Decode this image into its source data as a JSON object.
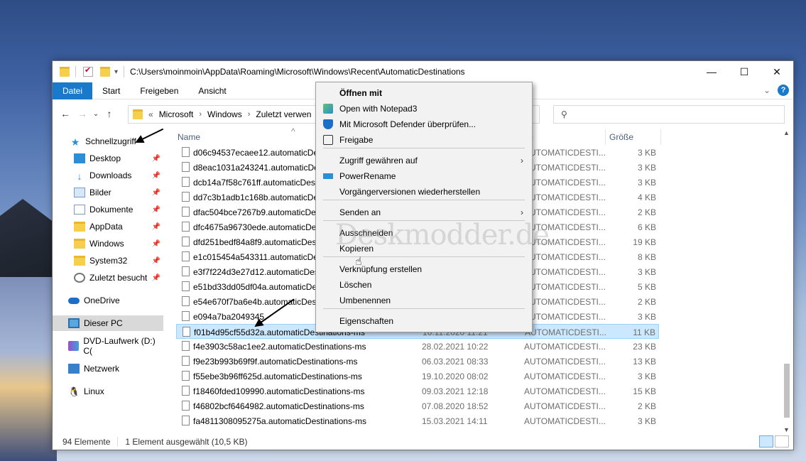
{
  "window": {
    "title_path": "C:\\Users\\moinmoin\\AppData\\Roaming\\Microsoft\\Windows\\Recent\\AutomaticDestinations",
    "minimize": "—",
    "maximize": "☐",
    "close": "✕"
  },
  "ribbon": {
    "tabs": [
      "Datei",
      "Start",
      "Freigeben",
      "Ansicht"
    ],
    "expand": "⌄",
    "help": "?"
  },
  "nav": {
    "back": "←",
    "forward": "→",
    "recent": "⌄",
    "up": "↑",
    "breadcrumb": [
      "Microsoft",
      "Windows",
      "Zuletzt verwen"
    ],
    "overflow": "«",
    "separator": "›",
    "search_icon": "⚲"
  },
  "sidebar": {
    "items": [
      {
        "label": "Schnellzugriff",
        "icon": "star-icon"
      },
      {
        "label": "Desktop",
        "icon": "desktop-icon",
        "pinned": true
      },
      {
        "label": "Downloads",
        "icon": "download-icon",
        "pinned": true
      },
      {
        "label": "Bilder",
        "icon": "pictures-icon",
        "pinned": true
      },
      {
        "label": "Dokumente",
        "icon": "documents-icon",
        "pinned": true
      },
      {
        "label": "AppData",
        "icon": "folder-icon",
        "pinned": true
      },
      {
        "label": "Windows",
        "icon": "folder-icon",
        "pinned": true
      },
      {
        "label": "System32",
        "icon": "folder-icon",
        "pinned": true
      },
      {
        "label": "Zuletzt besucht",
        "icon": "recent-icon",
        "pinned": true
      },
      {
        "label": "OneDrive",
        "icon": "cloud-icon"
      },
      {
        "label": "Dieser PC",
        "icon": "pc-icon",
        "selected": true
      },
      {
        "label": "DVD-Laufwerk (D:) C(",
        "icon": "dvd-icon"
      },
      {
        "label": "Netzwerk",
        "icon": "network-icon"
      },
      {
        "label": "Linux",
        "icon": "linux-icon"
      }
    ],
    "pin_glyph": "📌"
  },
  "columns": {
    "name": "Name",
    "date": "",
    "type": "p",
    "size": "Größe"
  },
  "files": [
    {
      "name": "d06c94537ecaee12.automaticDes",
      "date": "",
      "type": "AUTOMATICDESTI...",
      "size": "3 KB"
    },
    {
      "name": "d8eac1031a243241.automaticDes",
      "date": "",
      "type": "AUTOMATICDESTI...",
      "size": "3 KB"
    },
    {
      "name": "dcb14a7f58c761ff.automaticDest",
      "date": "",
      "type": "AUTOMATICDESTI...",
      "size": "3 KB"
    },
    {
      "name": "dd7c3b1adb1c168b.automaticDe",
      "date": "",
      "type": "AUTOMATICDESTI...",
      "size": "4 KB"
    },
    {
      "name": "dfac504bce7267b9.automaticDes",
      "date": "",
      "type": "AUTOMATICDESTI...",
      "size": "2 KB"
    },
    {
      "name": "dfc4675a96730ede.automaticDes",
      "date": "",
      "type": "AUTOMATICDESTI...",
      "size": "6 KB"
    },
    {
      "name": "dfd251bedf84a8f9.automaticDest",
      "date": "",
      "type": "AUTOMATICDESTI...",
      "size": "19 KB"
    },
    {
      "name": "e1c015454a543311.automaticDes",
      "date": "",
      "type": "AUTOMATICDESTI...",
      "size": "8 KB"
    },
    {
      "name": "e3f7f224d3e27d12.automaticDes",
      "date": "",
      "type": "AUTOMATICDESTI...",
      "size": "3 KB"
    },
    {
      "name": "e51bd33dd05df04a.automaticDes",
      "date": "",
      "type": "AUTOMATICDESTI...",
      "size": "5 KB"
    },
    {
      "name": "e54e670f7ba6e4b.automaticDesti",
      "date": "",
      "type": "AUTOMATICDESTI...",
      "size": "2 KB"
    },
    {
      "name": "e094a7ba2049345",
      "date": "",
      "type": "AUTOMATICDESTI...",
      "size": "3 KB"
    },
    {
      "name": "f01b4d95cf55d32a.automaticDestinations-ms",
      "date": "16.11.2020 11:21",
      "type": "AUTOMATICDESTI...",
      "size": "11 KB",
      "selected": true
    },
    {
      "name": "f4e3903c58ac1ee2.automaticDestinations-ms",
      "date": "28.02.2021 10:22",
      "type": "AUTOMATICDESTI...",
      "size": "23 KB"
    },
    {
      "name": "f9e23b993b69f9f.automaticDestinations-ms",
      "date": "06.03.2021 08:33",
      "type": "AUTOMATICDESTI...",
      "size": "13 KB"
    },
    {
      "name": "f55ebe3b96ff625d.automaticDestinations-ms",
      "date": "19.10.2020 08:02",
      "type": "AUTOMATICDESTI...",
      "size": "3 KB"
    },
    {
      "name": "f18460fded109990.automaticDestinations-ms",
      "date": "09.03.2021 12:18",
      "type": "AUTOMATICDESTI...",
      "size": "15 KB"
    },
    {
      "name": "f46802bcf6464982.automaticDestinations-ms",
      "date": "07.08.2020 18:52",
      "type": "AUTOMATICDESTI...",
      "size": "2 KB"
    },
    {
      "name": "fa4811308095275a.automaticDestinations-ms",
      "date": "15.03.2021 14:11",
      "type": "AUTOMATICDESTI...",
      "size": "3 KB"
    }
  ],
  "context_menu": {
    "items": [
      {
        "label": "Öffnen mit",
        "bold": true,
        "icon": ""
      },
      {
        "label": "Open with Notepad3",
        "icon": "notepad3-icon"
      },
      {
        "label": "Mit Microsoft Defender überprüfen...",
        "icon": "defender-shield-icon"
      },
      {
        "label": "Freigabe",
        "icon": "share-icon"
      },
      {
        "label": "Zugriff gewähren auf",
        "submenu": true
      },
      {
        "label": "PowerRename",
        "icon": "powerrename-icon"
      },
      {
        "label": "Vorgängerversionen wiederherstellen"
      },
      {
        "label": "Senden an",
        "submenu": true
      },
      {
        "label": "Ausschneiden"
      },
      {
        "label": "Kopieren"
      },
      {
        "label": "Verknüpfung erstellen"
      },
      {
        "label": "Löschen"
      },
      {
        "label": "Umbenennen"
      },
      {
        "label": "Eigenschaften"
      }
    ],
    "submenu_glyph": "›"
  },
  "watermark": "Deskmodder.de",
  "status": {
    "count": "94 Elemente",
    "selection": "1 Element ausgewählt (10,5 KB)"
  },
  "colors": {
    "accent": "#1979ca",
    "selection": "#cce8ff"
  }
}
